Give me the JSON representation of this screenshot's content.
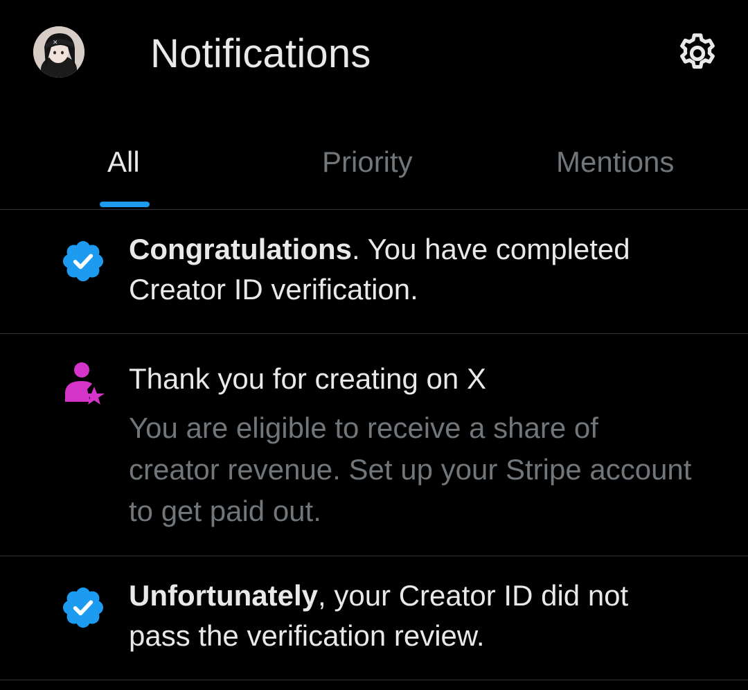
{
  "header": {
    "title": "Notifications",
    "avatar_icon": "user-avatar",
    "settings_icon": "gear-icon"
  },
  "tabs": [
    {
      "label": "All",
      "active": true
    },
    {
      "label": "Priority",
      "active": false
    },
    {
      "label": "Mentions",
      "active": false
    }
  ],
  "notifications": [
    {
      "icon": "verified-badge-icon",
      "bold": "Congratulations",
      "text": ".  You have completed Creator ID verification."
    },
    {
      "icon": "creator-star-person-icon",
      "title": "Thank you for creating on X",
      "detail": "You are eligible to receive a share of creator revenue. Set up your Stripe account to get paid out."
    },
    {
      "icon": "verified-badge-icon",
      "bold": "Unfortunately",
      "text": ", your Creator ID did not pass the verification review."
    }
  ],
  "colors": {
    "background": "#000000",
    "primary_text": "#e7e9ea",
    "secondary_text": "#71767b",
    "accent": "#1d9bf0",
    "creator_icon": "#d434c8",
    "divider": "#2f3336"
  }
}
